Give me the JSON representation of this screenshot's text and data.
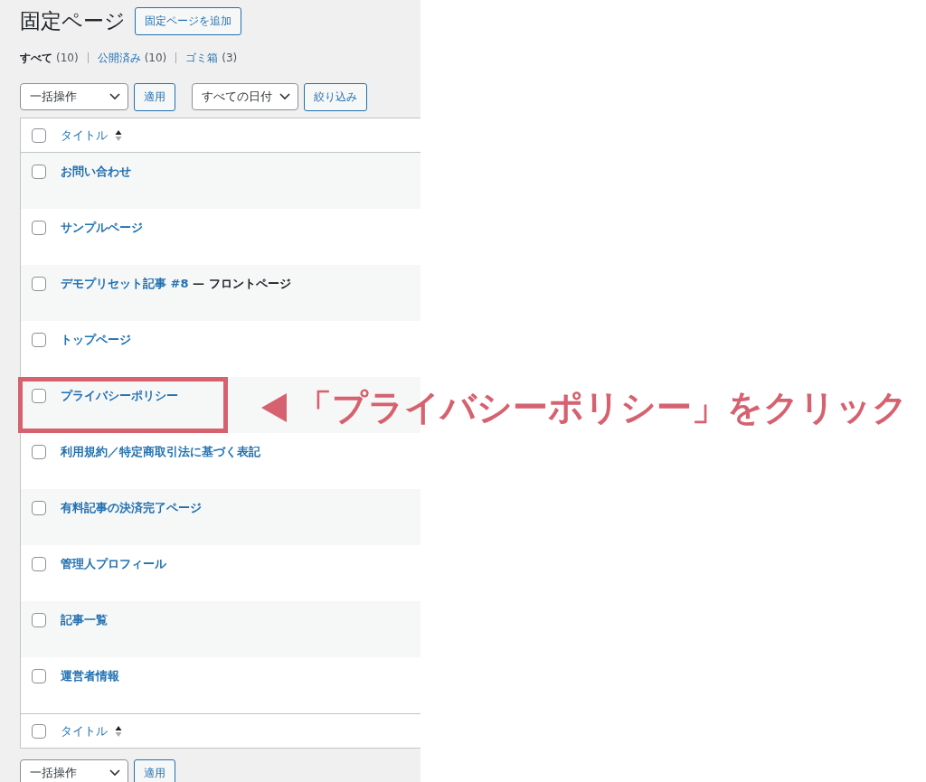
{
  "page": {
    "title": "固定ページ",
    "add_button": "固定ページを追加"
  },
  "views": [
    {
      "label": "すべて",
      "count": "(10)",
      "selected": true
    },
    {
      "label": "公開済み",
      "count": "(10)",
      "selected": false
    },
    {
      "label": "ゴミ箱",
      "count": "(3)",
      "selected": false
    }
  ],
  "top_toolbar": {
    "bulk_action": "一括操作",
    "apply": "適用",
    "date_filter": "すべての日付",
    "filter": "絞り込み"
  },
  "table": {
    "header": {
      "label": "タイトル",
      "checked": false
    },
    "rows": [
      {
        "title": "お問い合わせ",
        "checked": false,
        "highlighted": false
      },
      {
        "title": "サンプルページ",
        "checked": false,
        "highlighted": false
      },
      {
        "title": "デモプリセット記事 #8",
        "post_state": "— フロントページ",
        "checked": false,
        "highlighted": false
      },
      {
        "title": "トップページ",
        "checked": false,
        "highlighted": false
      },
      {
        "title": "プライバシーポリシー",
        "checked": false,
        "highlighted": true
      },
      {
        "title": "利用規約／特定商取引法に基づく表記",
        "checked": false,
        "highlighted": false
      },
      {
        "title": "有料記事の決済完了ページ",
        "checked": false,
        "highlighted": false
      },
      {
        "title": "管理人プロフィール",
        "checked": false,
        "highlighted": false
      },
      {
        "title": "記事一覧",
        "checked": false,
        "highlighted": false
      },
      {
        "title": "運営者情報",
        "checked": false,
        "highlighted": false
      }
    ],
    "footer": {
      "label": "タイトル",
      "checked": false
    }
  },
  "bottom_toolbar": {
    "bulk_action": "一括操作",
    "apply": "適用"
  },
  "callout": {
    "text": "「プライバシーポリシー」をクリック"
  }
}
